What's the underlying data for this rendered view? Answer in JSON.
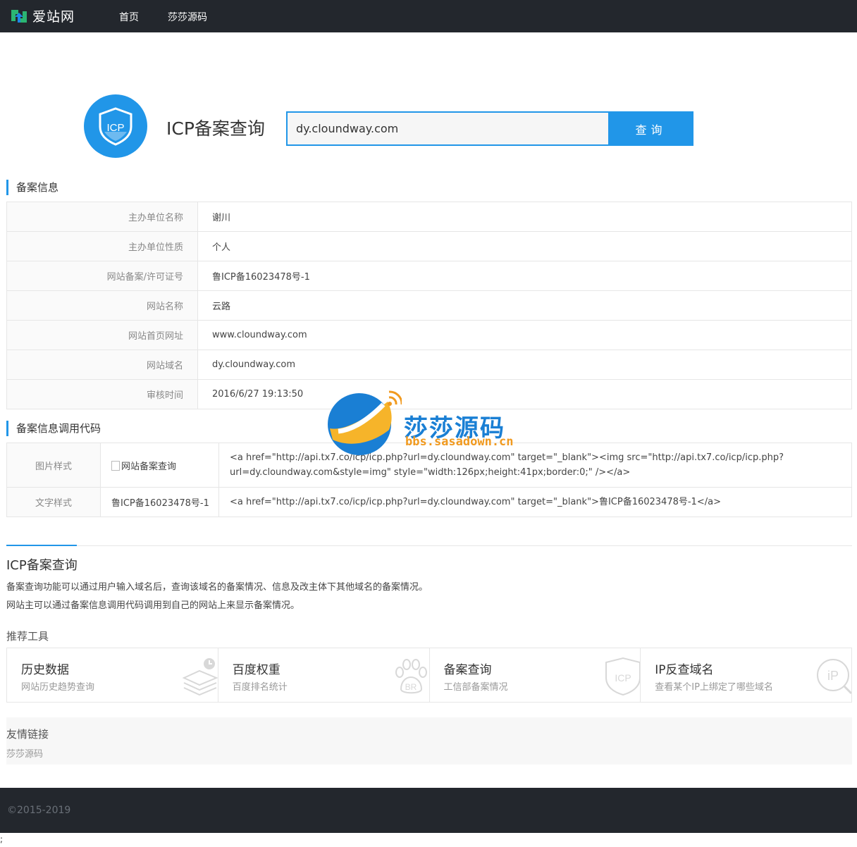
{
  "nav": {
    "brand": "爱站网",
    "items": [
      {
        "label": "首页"
      },
      {
        "label": "莎莎源码"
      }
    ]
  },
  "hero": {
    "logo_text": "ICP",
    "title": "ICP备案查询",
    "search_value": "dy.cloundway.com",
    "search_button": "查询"
  },
  "record": {
    "heading": "备案信息",
    "rows": [
      {
        "label": "主办单位名称",
        "value": "谢川"
      },
      {
        "label": "主办单位性质",
        "value": "个人"
      },
      {
        "label": "网站备案/许可证号",
        "value": "鲁ICP备16023478号-1"
      },
      {
        "label": "网站名称",
        "value": "云路"
      },
      {
        "label": "网站首页网址",
        "value": "www.cloundway.com"
      },
      {
        "label": "网站域名",
        "value": "dy.cloundway.com"
      },
      {
        "label": "审核时间",
        "value": "2016/6/27 19:13:50"
      }
    ]
  },
  "code": {
    "heading": "备案信息调用代码",
    "rows": [
      {
        "label": "图片样式",
        "sample": "网站备案查询",
        "code": "<a href=\"http://api.tx7.co/icp/icp.php?url=dy.cloundway.com\" target=\"_blank\"><img src=\"http://api.tx7.co/icp/icp.php?url=dy.cloundway.com&style=img\" style=\"width:126px;height:41px;border:0;\" /></a>"
      },
      {
        "label": "文字样式",
        "sample": "鲁ICP备16023478号-1",
        "code": "<a href=\"http://api.tx7.co/icp/icp.php?url=dy.cloundway.com\" target=\"_blank\">鲁ICP备16023478号-1</a>"
      }
    ]
  },
  "intro": {
    "title": "ICP备案查询",
    "lines": [
      "备案查询功能可以通过用户输入域名后，查询该域名的备案情况、信息及改主体下其他域名的备案情况。",
      "网站主可以通过备案信息调用代码调用到自己的网站上来显示备案情况。"
    ]
  },
  "tools": {
    "heading": "推荐工具",
    "items": [
      {
        "name": "历史数据",
        "desc": "网站历史趋势查询",
        "icon": "history-stack-icon"
      },
      {
        "name": "百度权重",
        "desc": "百度排名统计",
        "icon": "baidu-paw-icon",
        "badge": "BR"
      },
      {
        "name": "备案查询",
        "desc": "工信部备案情况",
        "icon": "icp-shield-icon",
        "badge": "ICP"
      },
      {
        "name": "IP反查域名",
        "desc": "查看某个IP上绑定了哪些域名",
        "icon": "ip-search-icon",
        "badge": "iP"
      }
    ]
  },
  "friends": {
    "heading": "友情链接",
    "links": [
      {
        "label": "莎莎源码"
      }
    ]
  },
  "footer": {
    "copyright": "©2015-2019"
  },
  "stray_char": ";",
  "watermark": {
    "title": "莎莎源码",
    "url": "bbs.sasadown.cn"
  },
  "colors": {
    "accent": "#2196e8",
    "topbar": "#23272d",
    "watermark_blue": "#1a7fd4",
    "watermark_orange": "#f19a1f"
  }
}
